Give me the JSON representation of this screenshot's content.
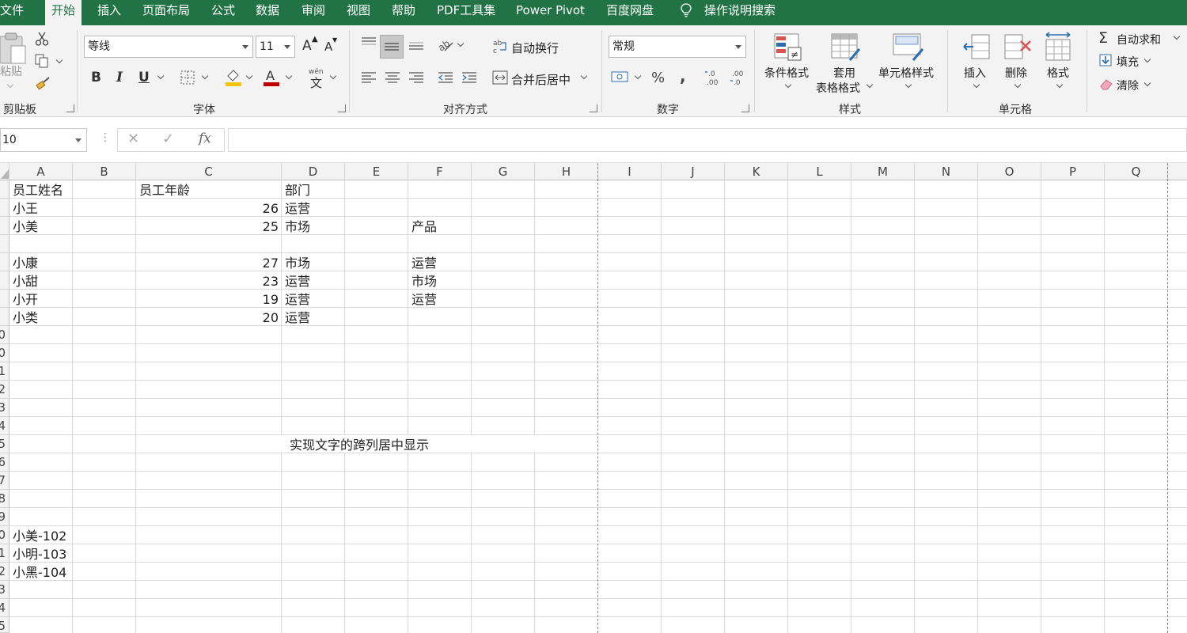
{
  "menu": {
    "tabs": [
      "文件",
      "开始",
      "插入",
      "页面布局",
      "公式",
      "数据",
      "审阅",
      "视图",
      "帮助",
      "PDF工具集",
      "Power Pivot",
      "百度网盘"
    ],
    "active_tab": "开始",
    "tell_me": "操作说明搜索"
  },
  "ribbon": {
    "clipboard": {
      "paste": "粘贴",
      "label": "剪贴板"
    },
    "font": {
      "name": "等线",
      "size": "11",
      "grow": "A",
      "shrink": "A",
      "bold": "B",
      "italic": "I",
      "underline": "U",
      "pinyin": "wén",
      "label": "字体"
    },
    "alignment": {
      "wrap": "自动换行",
      "merge": "合并后居中",
      "label": "对齐方式"
    },
    "number": {
      "format": "常规",
      "percent": "%",
      "comma": ",",
      "label": "数字"
    },
    "styles": {
      "conditional": "条件格式",
      "table_line1": "套用",
      "table_line2": "表格格式",
      "cell_styles": "单元格样式",
      "label": "样式"
    },
    "cells": {
      "insert": "插入",
      "delete": "删除",
      "format": "格式",
      "label": "单元格"
    },
    "editing": {
      "autosum": "自动求和",
      "fill": "填充",
      "clear": "清除"
    }
  },
  "formula_bar": {
    "name_box": "10",
    "cancel": "✕",
    "enter": "✓",
    "fx": "fx",
    "content": ""
  },
  "columns": [
    "A",
    "B",
    "C",
    "D",
    "E",
    "F",
    "G",
    "H",
    "I",
    "J",
    "K",
    "L",
    "M",
    "N",
    "O",
    "P",
    "Q"
  ],
  "row_numbers": [
    "",
    "",
    "",
    "",
    "",
    "",
    "",
    "",
    "0",
    "1",
    "2",
    "3",
    "4",
    "5",
    "6",
    "7",
    "8",
    "9",
    "0",
    "1",
    "2",
    "3",
    "4",
    "5"
  ],
  "cells": {
    "r1": {
      "a": "员工姓名",
      "c": "员工年龄",
      "d": "部门"
    },
    "r2": {
      "a": "小王",
      "c": "26",
      "d": "运营"
    },
    "r3": {
      "a": "小美",
      "c": "25",
      "d": "市场",
      "f": "产品"
    },
    "r5": {
      "a": "小康",
      "c": "27",
      "d": "市场",
      "f": "运营"
    },
    "r6": {
      "a": "小甜",
      "c": "23",
      "d": "运营",
      "f": "市场"
    },
    "r7": {
      "a": "小开",
      "c": "19",
      "d": "运营",
      "f": "运营"
    },
    "r8": {
      "a": "小类",
      "c": "20",
      "d": "运营"
    },
    "r15": {
      "merged": "实现文字的跨列居中显示"
    },
    "r20": {
      "a": "小美-102"
    },
    "r21": {
      "a": "小明-103"
    },
    "r22": {
      "a": "小黑-104"
    }
  },
  "colors": {
    "excel_green": "#217346",
    "fill_yellow": "#f2c40d",
    "font_red": "#c00000"
  }
}
